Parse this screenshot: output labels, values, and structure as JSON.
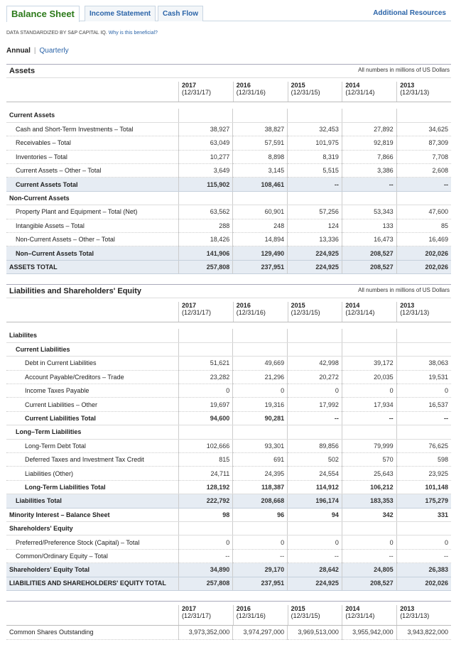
{
  "tabs": [
    {
      "label": "Balance Sheet"
    },
    {
      "label": "Income Statement"
    },
    {
      "label": "Cash Flow"
    }
  ],
  "additional_resources": "Additional Resources",
  "standardized": "DATA STANDARDIZED BY S&P CAPITAL IQ.",
  "why_link": "Why is this beneficial?",
  "period": {
    "annual": "Annual",
    "separator": "|",
    "quarterly": "Quarterly"
  },
  "years": [
    {
      "year": "2017",
      "date": "(12/31/17)"
    },
    {
      "year": "2016",
      "date": "(12/31/16)"
    },
    {
      "year": "2015",
      "date": "(12/31/15)"
    },
    {
      "year": "2014",
      "date": "(12/31/14)"
    },
    {
      "year": "2013",
      "date": "(12/31/13)"
    }
  ],
  "assets": {
    "title": "Assets",
    "units": "All numbers in millions of US Dollars",
    "rows": [
      {
        "type": "gap"
      },
      {
        "type": "hdr",
        "label": "Current Assets",
        "indent": 0
      },
      {
        "label": "Cash and Short-Term Investments – Total",
        "indent": 1,
        "v": [
          "38,927",
          "38,827",
          "32,453",
          "27,892",
          "34,625"
        ]
      },
      {
        "label": "Receivables – Total",
        "indent": 1,
        "v": [
          "63,049",
          "57,591",
          "101,975",
          "92,819",
          "87,309"
        ]
      },
      {
        "label": "Inventories – Total",
        "indent": 1,
        "v": [
          "10,277",
          "8,898",
          "8,319",
          "7,866",
          "7,708"
        ]
      },
      {
        "label": "Current Assets – Other – Total",
        "indent": 1,
        "v": [
          "3,649",
          "3,145",
          "5,515",
          "3,386",
          "2,608"
        ]
      },
      {
        "type": "total",
        "label": "Current Assets Total",
        "indent": 1,
        "v": [
          "115,902",
          "108,461",
          "--",
          "--",
          "--"
        ]
      },
      {
        "type": "hdr",
        "label": "Non-Current Assets",
        "indent": 0
      },
      {
        "label": "Property Plant and Equipment – Total (Net)",
        "indent": 1,
        "v": [
          "63,562",
          "60,901",
          "57,256",
          "53,343",
          "47,600"
        ]
      },
      {
        "label": "Intangible Assets – Total",
        "indent": 1,
        "v": [
          "288",
          "248",
          "124",
          "133",
          "85"
        ]
      },
      {
        "label": "Non-Current Assets – Other – Total",
        "indent": 1,
        "v": [
          "18,426",
          "14,894",
          "13,336",
          "16,473",
          "16,469"
        ]
      },
      {
        "type": "total",
        "label": "Non–Current Assets Total",
        "indent": 1,
        "v": [
          "141,906",
          "129,490",
          "224,925",
          "208,527",
          "202,026"
        ]
      },
      {
        "type": "grand",
        "label": "ASSETS TOTAL",
        "indent": 0,
        "v": [
          "257,808",
          "237,951",
          "224,925",
          "208,527",
          "202,026"
        ]
      }
    ]
  },
  "liabilities": {
    "title": "Liabilities and Shareholders' Equity",
    "units": "All numbers in millions of US Dollars",
    "rows": [
      {
        "type": "gap"
      },
      {
        "type": "hdr",
        "label": "Liabilites",
        "indent": 0
      },
      {
        "type": "hdr",
        "label": "Current Liabilities",
        "indent": 1
      },
      {
        "label": "Debt in Current Liabilities",
        "indent": 2,
        "v": [
          "51,621",
          "49,669",
          "42,998",
          "39,172",
          "38,063"
        ]
      },
      {
        "label": "Account Payable/Creditors – Trade",
        "indent": 2,
        "v": [
          "23,282",
          "21,296",
          "20,272",
          "20,035",
          "19,531"
        ]
      },
      {
        "label": "Income Taxes Payable",
        "indent": 2,
        "v": [
          "0",
          "0",
          "0",
          "0",
          "0"
        ]
      },
      {
        "label": "Current Liabilities – Other",
        "indent": 2,
        "v": [
          "19,697",
          "19,316",
          "17,992",
          "17,934",
          "16,537"
        ]
      },
      {
        "type": "hdrv",
        "label": "Current Liabilities Total",
        "indent": 2,
        "v": [
          "94,600",
          "90,281",
          "--",
          "--",
          "--"
        ]
      },
      {
        "type": "hdr",
        "label": "Long–Term Liabilities",
        "indent": 1
      },
      {
        "label": "Long-Term Debt Total",
        "indent": 2,
        "v": [
          "102,666",
          "93,301",
          "89,856",
          "79,999",
          "76,625"
        ]
      },
      {
        "label": "Deferred Taxes and Investment Tax Credit",
        "indent": 2,
        "v": [
          "815",
          "691",
          "502",
          "570",
          "598"
        ]
      },
      {
        "label": "Liabilities (Other)",
        "indent": 2,
        "v": [
          "24,711",
          "24,395",
          "24,554",
          "25,643",
          "23,925"
        ]
      },
      {
        "type": "hdrv",
        "label": "Long-Term Liabilities Total",
        "indent": 2,
        "v": [
          "128,192",
          "118,387",
          "114,912",
          "106,212",
          "101,148"
        ]
      },
      {
        "type": "total",
        "label": "Liabilities Total",
        "indent": 1,
        "v": [
          "222,792",
          "208,668",
          "196,174",
          "183,353",
          "175,279"
        ]
      },
      {
        "type": "hdrv",
        "label": "Minority Interest – Balance Sheet",
        "indent": 0,
        "v": [
          "98",
          "96",
          "94",
          "342",
          "331"
        ]
      },
      {
        "type": "hdr",
        "label": "Shareholders' Equity",
        "indent": 0
      },
      {
        "label": "Preferred/Preference Stock (Capital) – Total",
        "indent": 1,
        "v": [
          "0",
          "0",
          "0",
          "0",
          "0"
        ]
      },
      {
        "label": "Common/Ordinary Equity – Total",
        "indent": 1,
        "v": [
          "--",
          "--",
          "--",
          "--",
          "--"
        ]
      },
      {
        "type": "total",
        "label": "Shareholders' Equity Total",
        "indent": 0,
        "v": [
          "34,890",
          "29,170",
          "28,642",
          "24,805",
          "26,383"
        ]
      },
      {
        "type": "grand",
        "wrap": true,
        "label": "LIABILITIES AND SHAREHOLDERS' EQUITY TOTAL",
        "indent": 0,
        "v": [
          "257,808",
          "237,951",
          "224,925",
          "208,527",
          "202,026"
        ]
      }
    ]
  },
  "shares": {
    "label": "Common Shares Outstanding",
    "v": [
      "3,973,352,000",
      "3,974,297,000",
      "3,969,513,000",
      "3,955,942,000",
      "3,943,822,000"
    ]
  }
}
